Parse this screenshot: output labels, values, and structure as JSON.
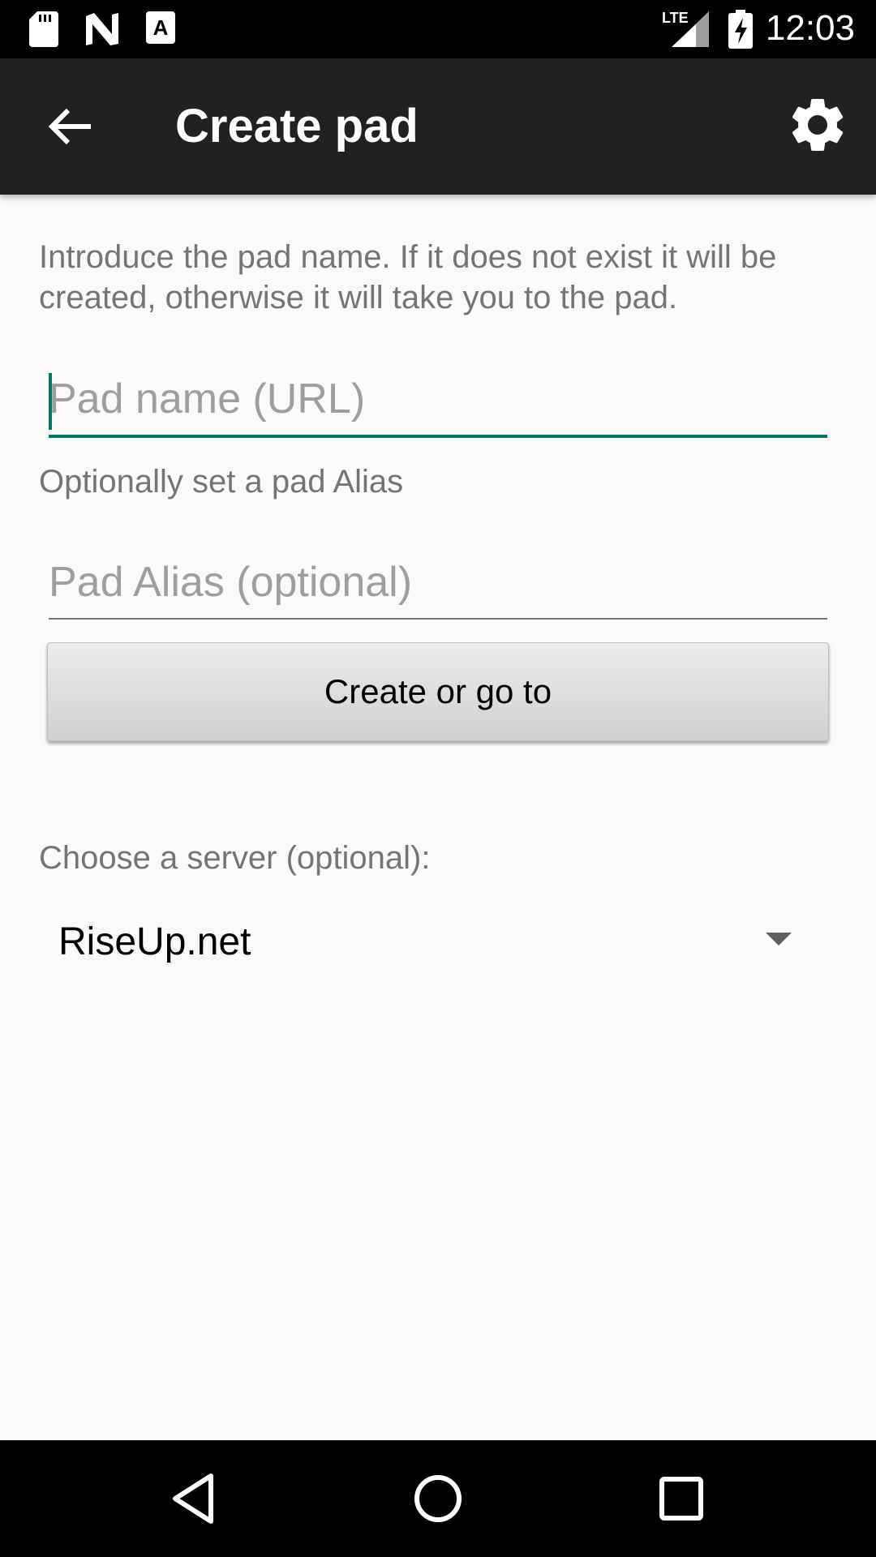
{
  "status_bar": {
    "time": "12:03",
    "network": "LTE",
    "icons": [
      "sd-card-icon",
      "n-logo-icon",
      "keyboard-a-icon",
      "signal-icon",
      "battery-charging-icon"
    ]
  },
  "app_bar": {
    "title": "Create pad",
    "icons": [
      "back-arrow-icon",
      "gear-icon"
    ]
  },
  "content": {
    "intro_text": "Introduce the pad name. If it does not exist it will be created, otherwise it will take you to the pad.",
    "pad_name": {
      "placeholder": "Pad name (URL)",
      "value": ""
    },
    "alias_label": "Optionally set a pad Alias",
    "pad_alias": {
      "placeholder": "Pad Alias (optional)",
      "value": ""
    },
    "create_button_label": "Create or go to",
    "server_label": "Choose a server (optional):",
    "server_selected": "RiseUp.net"
  },
  "colors": {
    "accent": "#00796b",
    "app_bar": "#212121",
    "background": "#fafafa"
  },
  "nav_bar": {
    "icons": [
      "back-triangle-icon",
      "home-circle-icon",
      "recents-square-icon"
    ]
  }
}
